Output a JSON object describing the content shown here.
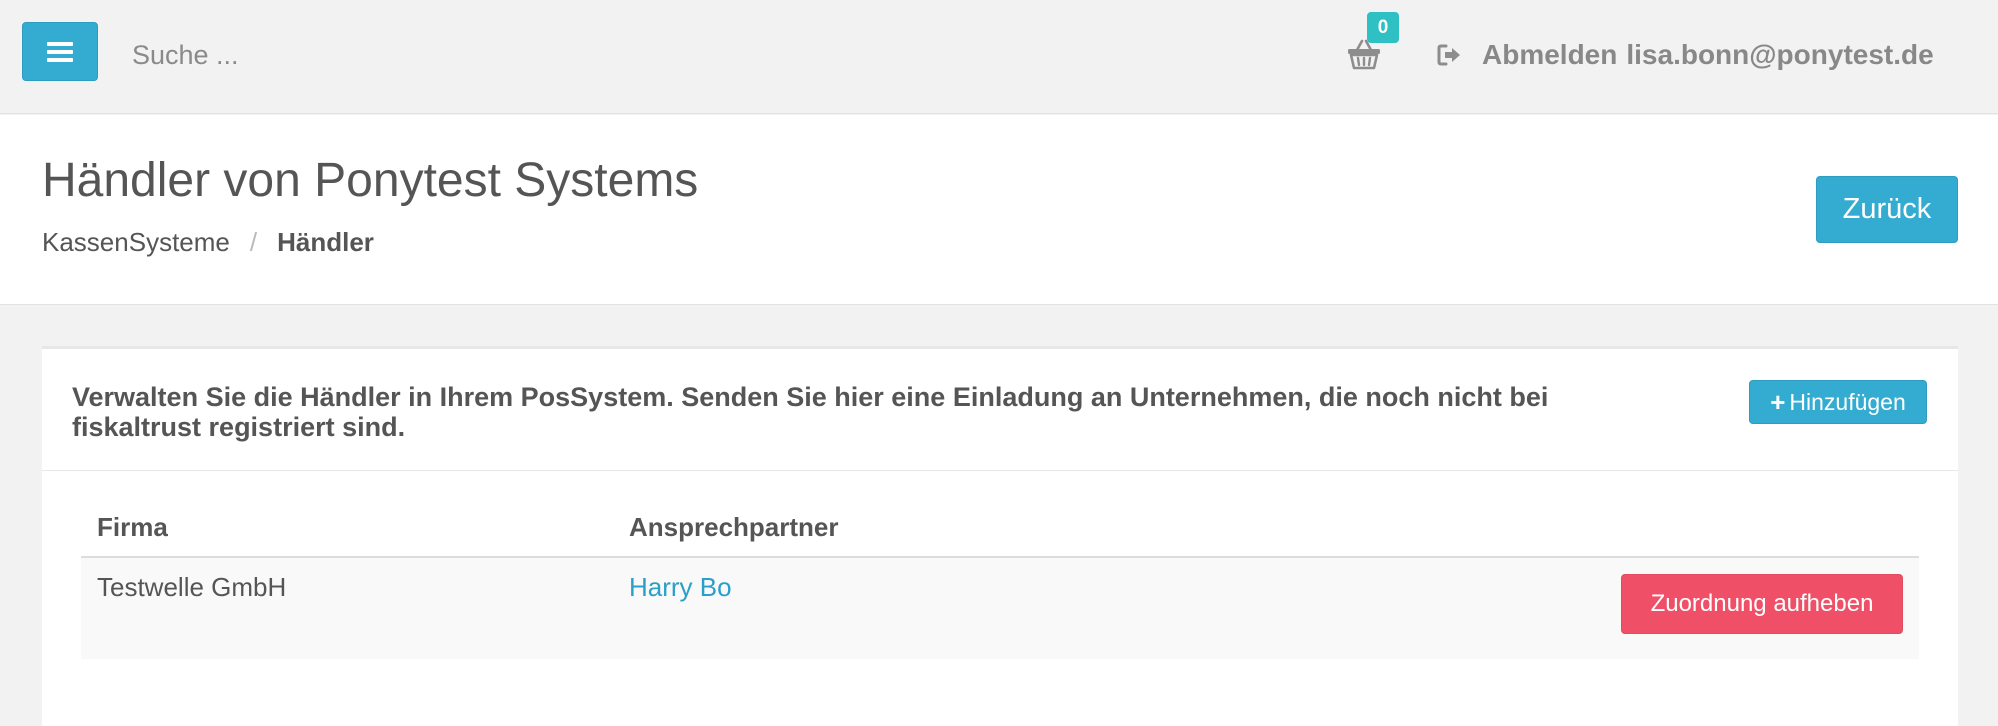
{
  "topbar": {
    "search_placeholder": "Suche ...",
    "cart_count": "0",
    "logout_label": "Abmelden",
    "user_email": "lisa.bonn@ponytest.de"
  },
  "header": {
    "title": "Händler von Ponytest Systems",
    "breadcrumb": [
      "KassenSysteme",
      "Händler"
    ],
    "back_label": "Zurück"
  },
  "card": {
    "description": "Verwalten Sie die Händler in Ihrem PosSystem. Senden Sie hier eine Einladung an Unternehmen, die noch nicht bei fiskaltrust registriert sind.",
    "add_label": "Hinzufügen",
    "columns": [
      "Firma",
      "Ansprechpartner"
    ],
    "rows": [
      {
        "company": "Testwelle GmbH",
        "contact": "Harry Bo",
        "action_label": "Zuordnung aufheben"
      }
    ]
  },
  "colors": {
    "primary": "#34acd2",
    "danger": "#ef5067",
    "badge": "#2fc0c4",
    "link": "#2a9fc9"
  },
  "icons": [
    "menu-icon",
    "basket-icon",
    "logout-icon",
    "plus-icon"
  ]
}
